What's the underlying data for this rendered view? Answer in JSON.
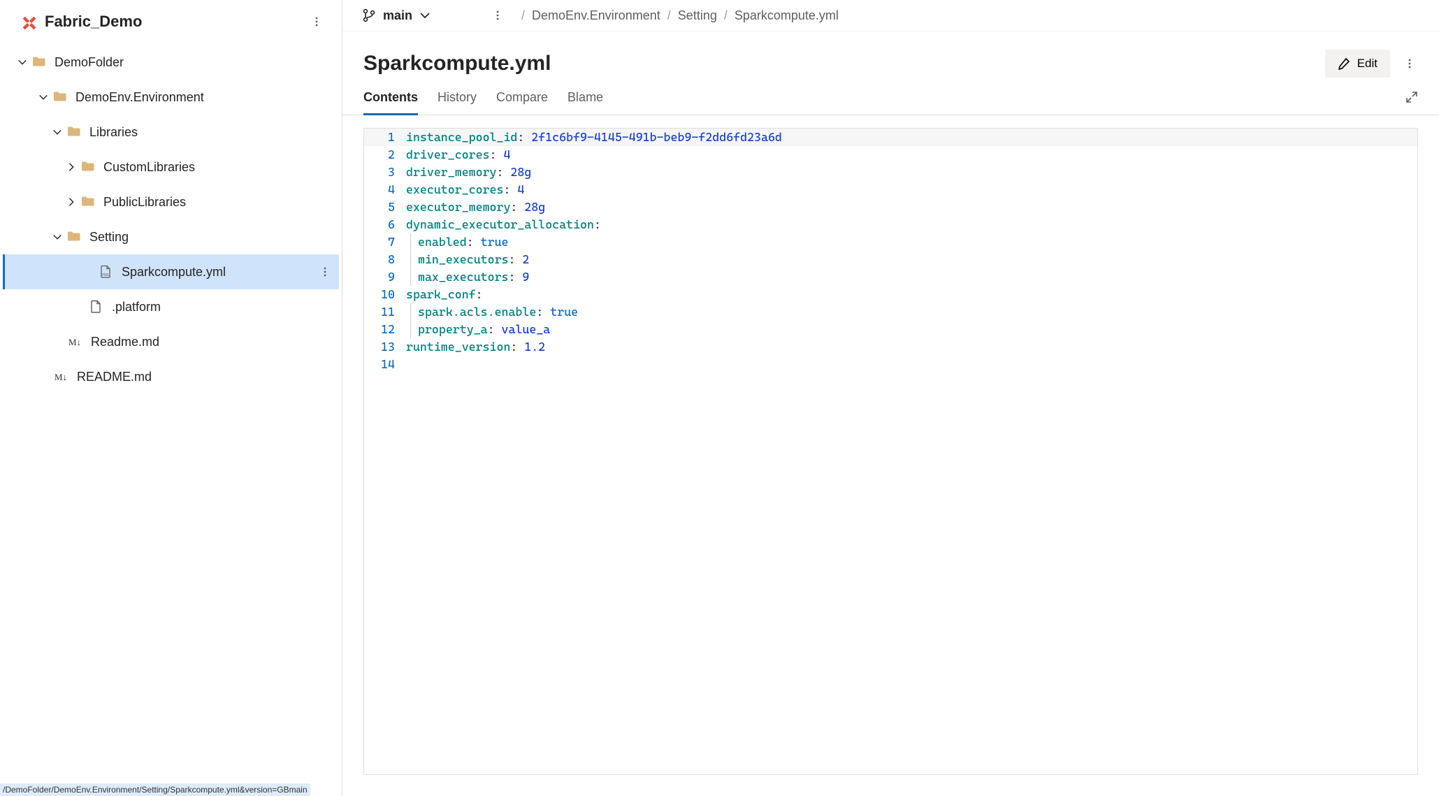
{
  "repo": {
    "name": "Fabric_Demo"
  },
  "tree": {
    "n0": {
      "label": "DemoFolder",
      "indent": 20,
      "chev": "down",
      "type": "folder"
    },
    "n1": {
      "label": "DemoEnv.Environment",
      "indent": 50,
      "chev": "down",
      "type": "folder"
    },
    "n2": {
      "label": "Libraries",
      "indent": 70,
      "chev": "down",
      "type": "folder"
    },
    "n3": {
      "label": "CustomLibraries",
      "indent": 90,
      "chev": "right",
      "type": "folder"
    },
    "n4": {
      "label": "PublicLibraries",
      "indent": 90,
      "chev": "right",
      "type": "folder"
    },
    "n5": {
      "label": "Setting",
      "indent": 70,
      "chev": "down",
      "type": "folder"
    },
    "n6": {
      "label": "Sparkcompute.yml",
      "indent": 116,
      "chev": "none",
      "type": "yml",
      "selected": true
    },
    "n7": {
      "label": ".platform",
      "indent": 102,
      "chev": "none",
      "type": "file"
    },
    "n8": {
      "label": "Readme.md",
      "indent": 72,
      "chev": "none",
      "type": "md"
    },
    "n9": {
      "label": "README.md",
      "indent": 52,
      "chev": "none",
      "type": "md"
    }
  },
  "statusUrl": "/DemoFolder/DemoEnv.Environment/Setting/Sparkcompute.yml&version=GBmain",
  "branch": {
    "name": "main"
  },
  "breadcrumbs": {
    "p0": "DemoEnv.Environment",
    "p1": "Setting",
    "p2": "Sparkcompute.yml"
  },
  "file": {
    "title": "Sparkcompute.yml",
    "editLabel": "Edit"
  },
  "tabs": {
    "contents": "Contents",
    "history": "History",
    "compare": "Compare",
    "blame": "Blame"
  },
  "codeTokens": {
    "l1": {
      "n": "1",
      "t": [
        [
          "key",
          "instance_pool_id"
        ],
        [
          "plain",
          ": "
        ],
        [
          "str",
          "2f1c6bf9-4145-491b-beb9-f2dd6fd23a6d"
        ]
      ],
      "hl": true
    },
    "l2": {
      "n": "2",
      "t": [
        [
          "key",
          "driver_cores"
        ],
        [
          "plain",
          ": "
        ],
        [
          "num",
          "4"
        ]
      ]
    },
    "l3": {
      "n": "3",
      "t": [
        [
          "key",
          "driver_memory"
        ],
        [
          "plain",
          ": "
        ],
        [
          "str",
          "28g"
        ]
      ]
    },
    "l4": {
      "n": "4",
      "t": [
        [
          "key",
          "executor_cores"
        ],
        [
          "plain",
          ": "
        ],
        [
          "num",
          "4"
        ]
      ]
    },
    "l5": {
      "n": "5",
      "t": [
        [
          "key",
          "executor_memory"
        ],
        [
          "plain",
          ": "
        ],
        [
          "str",
          "28g"
        ]
      ]
    },
    "l6": {
      "n": "6",
      "t": [
        [
          "key",
          "dynamic_executor_allocation"
        ],
        [
          "plain",
          ":"
        ]
      ]
    },
    "l7": {
      "n": "7",
      "indent": true,
      "t": [
        [
          "key",
          "enabled"
        ],
        [
          "plain",
          ": "
        ],
        [
          "bool",
          "true"
        ]
      ]
    },
    "l8": {
      "n": "8",
      "indent": true,
      "t": [
        [
          "key",
          "min_executors"
        ],
        [
          "plain",
          ": "
        ],
        [
          "num",
          "2"
        ]
      ]
    },
    "l9": {
      "n": "9",
      "indent": true,
      "t": [
        [
          "key",
          "max_executors"
        ],
        [
          "plain",
          ": "
        ],
        [
          "num",
          "9"
        ]
      ]
    },
    "l10": {
      "n": "10",
      "t": [
        [
          "key",
          "spark_conf"
        ],
        [
          "plain",
          ":"
        ]
      ]
    },
    "l11": {
      "n": "11",
      "indent": true,
      "t": [
        [
          "key",
          "spark.acls.enable"
        ],
        [
          "plain",
          ": "
        ],
        [
          "bool",
          "true"
        ]
      ]
    },
    "l12": {
      "n": "12",
      "indent": true,
      "t": [
        [
          "key",
          "property_a"
        ],
        [
          "plain",
          ": "
        ],
        [
          "str",
          "value_a"
        ]
      ]
    },
    "l13": {
      "n": "13",
      "t": [
        [
          "key",
          "runtime_version"
        ],
        [
          "plain",
          ": "
        ],
        [
          "num",
          "1.2"
        ]
      ]
    },
    "l14": {
      "n": "14",
      "t": []
    }
  }
}
